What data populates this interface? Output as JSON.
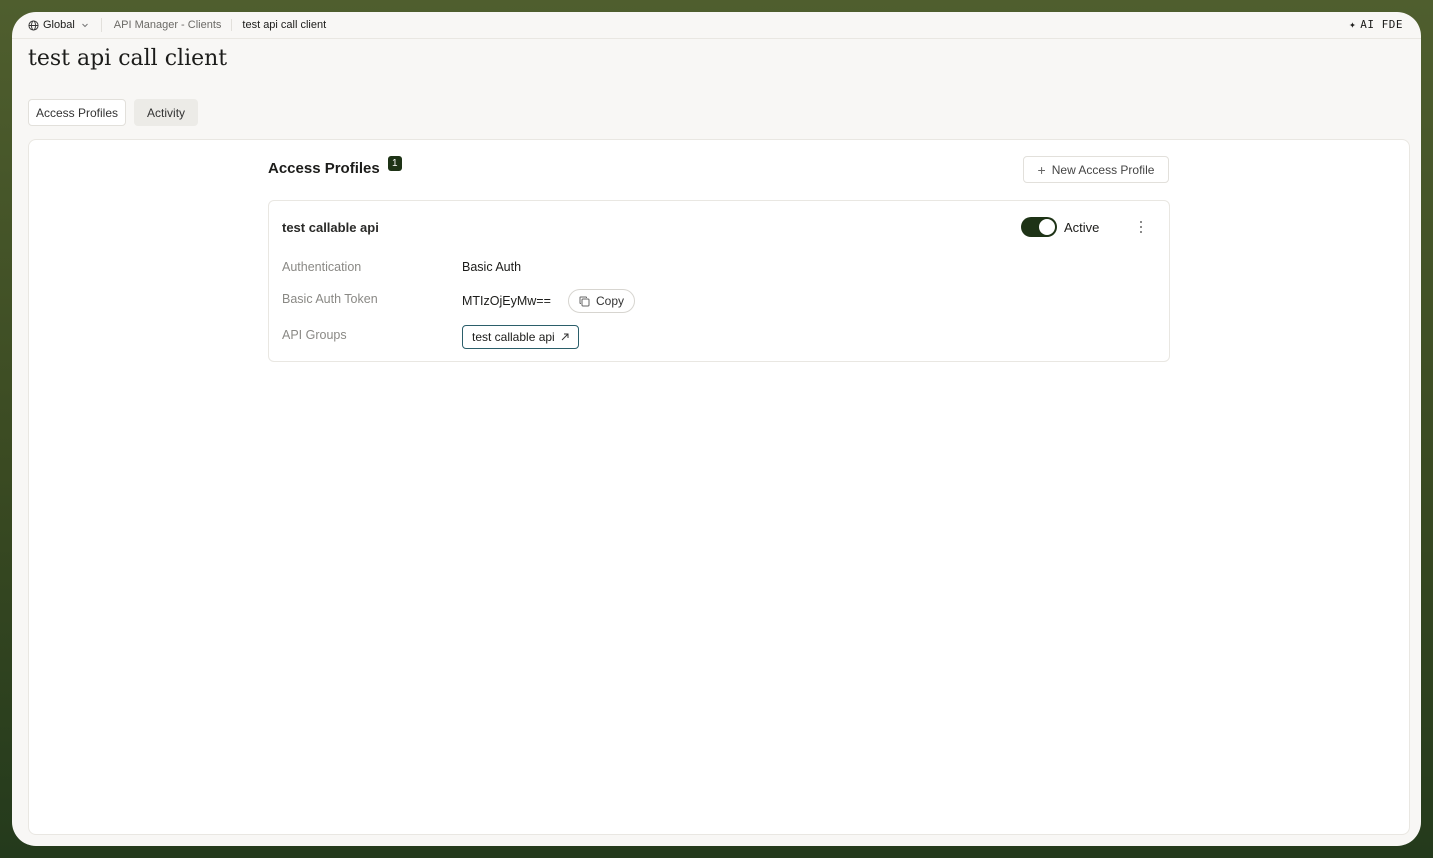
{
  "topbar": {
    "workspace": "Global",
    "breadcrumbs": [
      "API Manager - Clients",
      "test api call client"
    ],
    "assistant": "AI FDE"
  },
  "page": {
    "title": "test api call client",
    "tabs": [
      {
        "label": "Access Profiles",
        "active": true
      },
      {
        "label": "Activity",
        "active": false
      }
    ]
  },
  "section": {
    "title": "Access Profiles",
    "count": "1",
    "new_button": "New Access Profile"
  },
  "profile": {
    "name": "test callable api",
    "status_label": "Active",
    "active": true,
    "fields": {
      "auth_label": "Authentication",
      "auth_value": "Basic Auth",
      "token_label": "Basic Auth Token",
      "token_value": "MTIzOjEyMw==",
      "copy_label": "Copy",
      "groups_label": "API Groups",
      "groups": [
        "test callable api"
      ]
    }
  },
  "colors": {
    "accent": "#1e3316",
    "chip_border": "#2b5e6a",
    "background": "#f8f7f5"
  }
}
